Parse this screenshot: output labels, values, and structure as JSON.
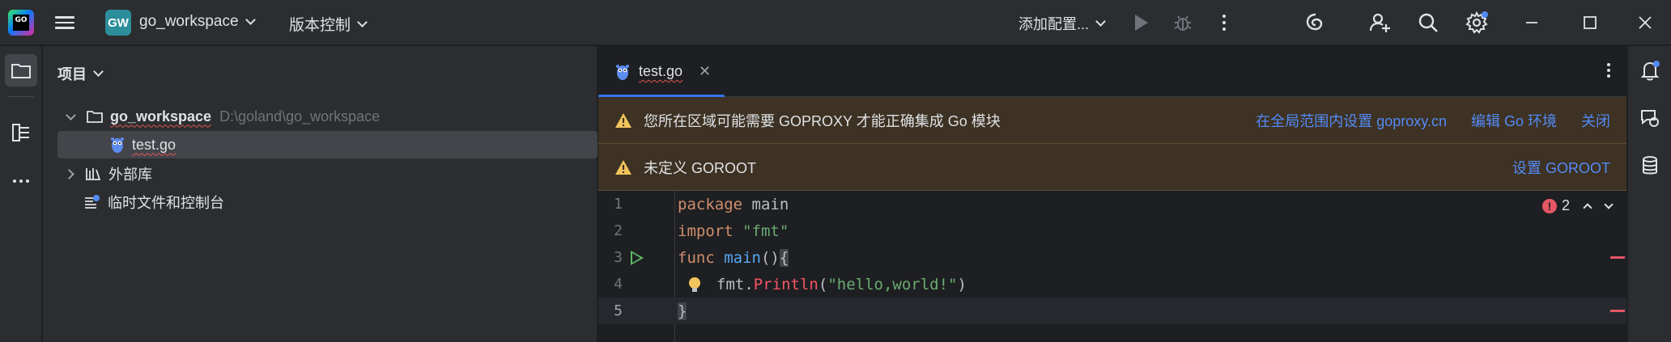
{
  "titlebar": {
    "app_logo_text": "GO",
    "project_badge": "GW",
    "project_name": "go_workspace",
    "vcs_label": "版本控制",
    "run_config_label": "添加配置..."
  },
  "icons": {
    "play": "run-icon",
    "debug": "debug-icon",
    "more": "more-vertical-icon",
    "ai": "ai-assistant-icon",
    "add_user": "code-with-me-icon",
    "search": "search-icon",
    "settings": "gear-icon"
  },
  "project_panel": {
    "title": "项目",
    "tree": [
      {
        "label": "go_workspace",
        "hint": "D:\\goland\\go_workspace"
      },
      {
        "label": "test.go"
      },
      {
        "label": "外部库"
      },
      {
        "label": "临时文件和控制台"
      }
    ]
  },
  "editor": {
    "tab_label": "test.go",
    "tab_close": "✕",
    "banner1": {
      "text": "您所在区域可能需要 GOPROXY 才能正确集成 Go 模块",
      "links": [
        "在全局范围内设置 goproxy.cn",
        "编辑 Go 环境",
        "关闭"
      ]
    },
    "banner2": {
      "text": "未定义 GOROOT",
      "links": [
        "设置 GOROOT"
      ]
    },
    "line_numbers": [
      "1",
      "2",
      "3",
      "4",
      "5"
    ],
    "code": {
      "l1_kw": "package",
      "l1_name": " main",
      "l2_kw": "import",
      "l2_str": " \"fmt\"",
      "l3_kw": "func",
      "l3_fn": " main",
      "l3_rest": "()",
      "l3_brace": "{",
      "l4_pkg": "fmt",
      "l4_dot": ".",
      "l4_call": "Println",
      "l4_open": "(",
      "l4_str": "\"hello,world!\"",
      "l4_close": ")",
      "l5_brace": "}"
    },
    "error_count": "2",
    "error_glyph": "!"
  },
  "colors": {
    "accent": "#3574f0",
    "warning_bg": "#3d3223",
    "error": "#e55765"
  }
}
